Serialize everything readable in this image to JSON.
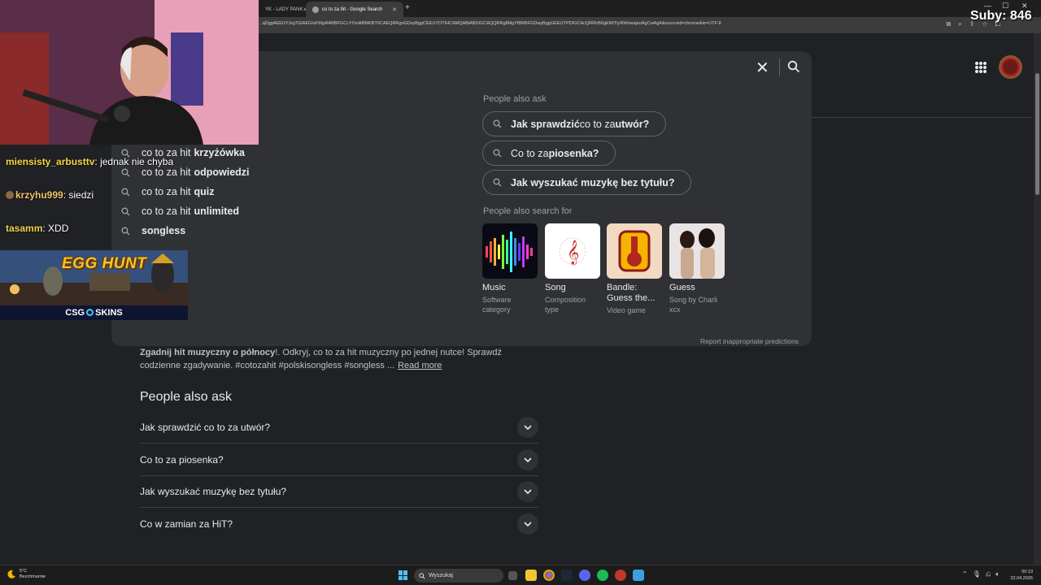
{
  "browser": {
    "tabs": [
      {
        "label": "YK - LADY PANK",
        "active": false
      },
      {
        "label": "co to za hit - Google Search",
        "active": true
      }
    ],
    "new_tab": "+",
    "url": "...qDggAEEUYJxg7GIAEGIoFMg4IABBFGCcYOxiABBiKBTIICAEQRRgnGDsyBggCEEUYOTIHCAMQABiABDIGCAQQRRg8MgYIBRBFGDwyBggGEEUYPDIGCAcQRRhB0gEIMTIyNWowajeoAgCwAgA&sourceid=chrome&ie=UTF-8"
  },
  "overlay": {
    "subs": "Suby: 846",
    "chat": [
      {
        "user": "miensisty_arbusttv",
        "text": " jednak nie chyba"
      },
      {
        "user": "krzyhu999",
        "text": " siedzi"
      },
      {
        "user": "tasamm",
        "text": " XDD"
      }
    ],
    "banner_title": "EGG HUNT",
    "banner_brand": "CSG SKINS",
    "banner_brand_a": "CSG",
    "banner_brand_b": "SKINS"
  },
  "suggestions": [
    {
      "prefix": "co to za hit",
      "suffix": "krzyżówka"
    },
    {
      "prefix": "co to za hit",
      "suffix": "odpowiedzi"
    },
    {
      "prefix": "co to za hit",
      "suffix": "quiz"
    },
    {
      "prefix": "co to za hit",
      "suffix": "unlimited"
    },
    {
      "prefix": "",
      "suffix": "songless"
    }
  ],
  "people_also_ask_panel": {
    "title": "People also ask",
    "chips": [
      {
        "a": "Jak sprawdzić",
        "b": " co to za ",
        "c": "utwór?"
      },
      {
        "a": "Co to za ",
        "b": "piosenka?",
        "c": ""
      },
      {
        "a": "Jak wyszukać muzykę bez tytułu?",
        "b": "",
        "c": ""
      }
    ]
  },
  "people_also_search": {
    "title": "People also search for",
    "cards": [
      {
        "title": "Music",
        "sub1": "Software",
        "sub2": "category"
      },
      {
        "title": "Song",
        "sub1": "Composition",
        "sub2": "type"
      },
      {
        "title": "Bandle:",
        "title2": "Guess the...",
        "sub1": "Video game",
        "sub2": ""
      },
      {
        "title": "Guess",
        "sub1": "Song by Charli",
        "sub2": "xcx"
      }
    ],
    "report": "Report inappropriate predictions"
  },
  "result": {
    "snippet_bold": "Zgadnij hit muzyczny o północy",
    "snippet_rest": "!. Odkryj, co to za hit muzyczny po jednej nutce! Sprawdź codzienne zgadywanie. #cotozahit #polskisongless #songless ...",
    "read_more": "Read more"
  },
  "paa": {
    "title": "People also ask",
    "items": [
      "Jak sprawdzić co to za utwór?",
      "Co to za piosenka?",
      "Jak wyszukać muzykę bez tytułu?",
      "Co w zamian za HiT?"
    ]
  },
  "taskbar": {
    "weather_temp": "5°C",
    "weather_desc": "Bezchmurnie",
    "search_placeholder": "Wyszukaj",
    "time": "00:13",
    "date": "22.04.2026"
  },
  "colors": {
    "page_bg": "#202124",
    "panel_bg": "#303134",
    "accent_blue": "#4cc2ff",
    "chat_user": "#f5d742"
  }
}
